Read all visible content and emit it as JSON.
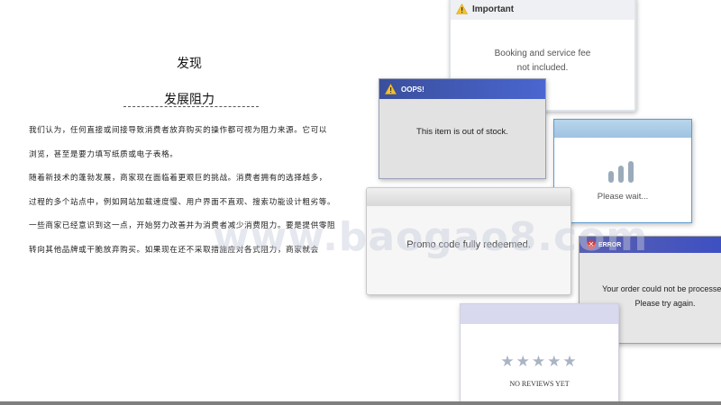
{
  "slide": {
    "title_main": "发现",
    "title_sub": "发展阻力",
    "paragraphs": [
      "我们认为，任何直接或间接导致消费者放弃购买的操作都可视为阻力来源。它可以",
      "浏览，甚至是要力填写纸质或电子表格。",
      "随着新技术的蓬勃发展，商家现在面临着更艰巨的挑战。消费者拥有的选择越多，",
      "过程的多个站点中，例如网站加载速度慢、用户界面不直观、搜索功能设计粗劣等。",
      "一些商家已经意识到这一点，开始努力改善并为消费者减少消费阻力。要是提供零阻",
      "转向其他品牌或干脆放弃购买。如果现在还不采取措施应对各式阻力，商家就会"
    ]
  },
  "dialogs": {
    "important": {
      "title": "Important",
      "message_line1": "Booking and service fee",
      "message_line2": "not included."
    },
    "oops": {
      "title": "OOPS!",
      "message": "This item is out of stock."
    },
    "wait": {
      "message": "Please wait..."
    },
    "promo": {
      "message": "Promo code fully redeemed."
    },
    "error": {
      "title": "ERROR",
      "message_line1": "Your order could not be processed.",
      "message_line2": "Please try again."
    },
    "reviews": {
      "stars": "★★★★★",
      "message": "NO REVIEWS YET"
    }
  },
  "watermark": "www.baogao8.com",
  "colors": {
    "oops_header": "#3a4f9c",
    "error_header": "#3b4fc4",
    "wait_header": "#9fc3e2",
    "warning_yellow": "#f2c12e",
    "error_red": "#e03a3a"
  },
  "loading_bar_levels": [
    0.55,
    0.8,
    1.0
  ]
}
